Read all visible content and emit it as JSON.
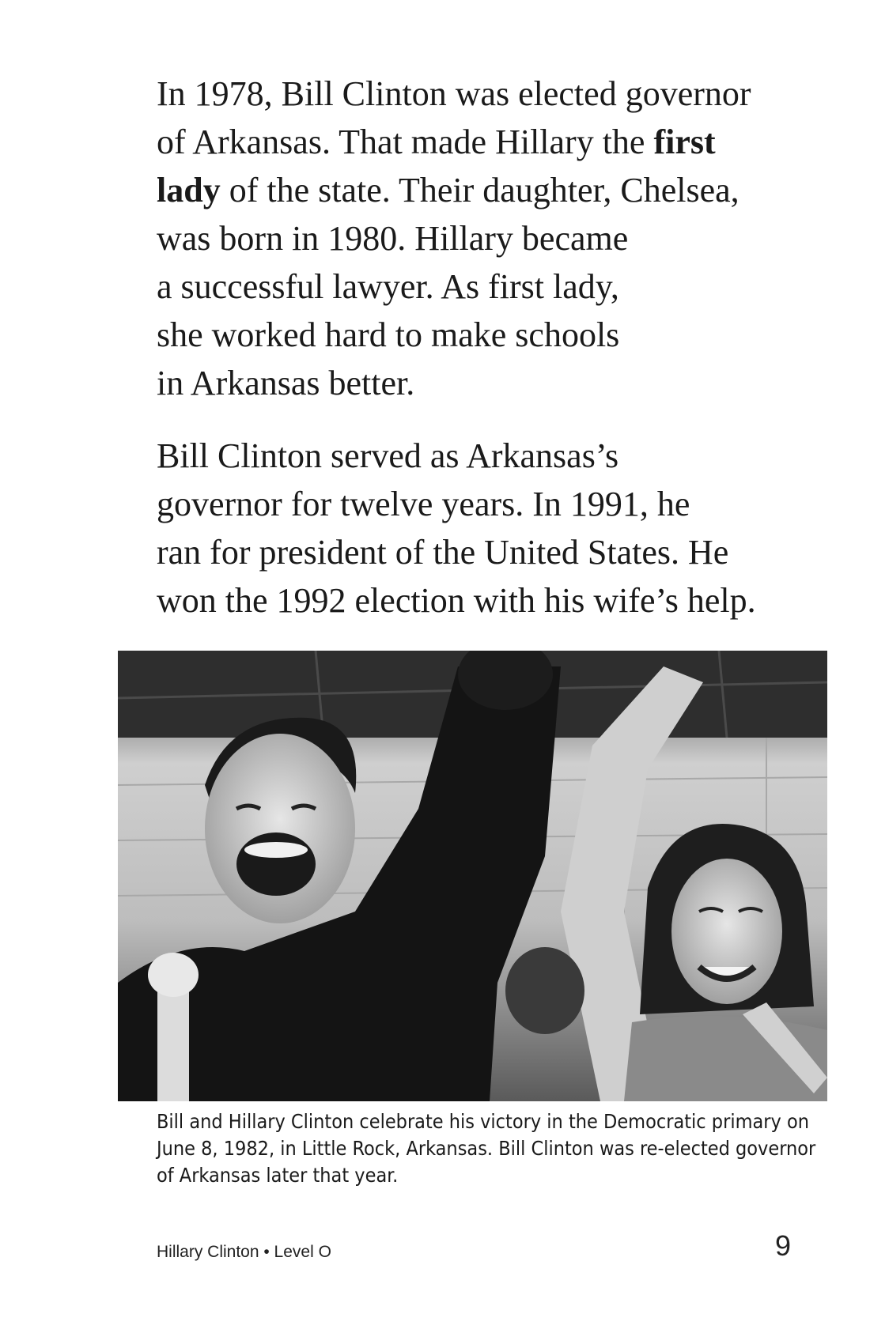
{
  "paragraph1": {
    "line1": "In 1978, Bill Clinton was elected governor",
    "line2_pre": "of Arkansas. That made Hillary the ",
    "bold_term_part1": "first",
    "bold_term_part2": "lady",
    "line3_post": " of the state. Their daughter, Chelsea,",
    "line4": "was born in 1980. Hillary became",
    "line5": "a successful lawyer. As first lady,",
    "line6": "she worked hard to make schools",
    "line7": "in Arkansas better."
  },
  "paragraph2": {
    "line1": "Bill Clinton served as Arkansas’s",
    "line2": "governor for twelve years. In 1991, he",
    "line3": "ran for president of the United States. He",
    "line4": "won the 1992 election with his wife’s help."
  },
  "photo": {
    "description_icon": "black-and-white-photo"
  },
  "caption": {
    "line1": "Bill and Hillary Clinton celebrate his victory in the Democratic primary on",
    "line2": "June 8, 1982, in Little Rock, Arkansas. Bill Clinton was re-elected governor",
    "line3": "of Arkansas later that year."
  },
  "footer": {
    "book_title": "Hillary Clinton • Level O",
    "page_number": "9"
  }
}
